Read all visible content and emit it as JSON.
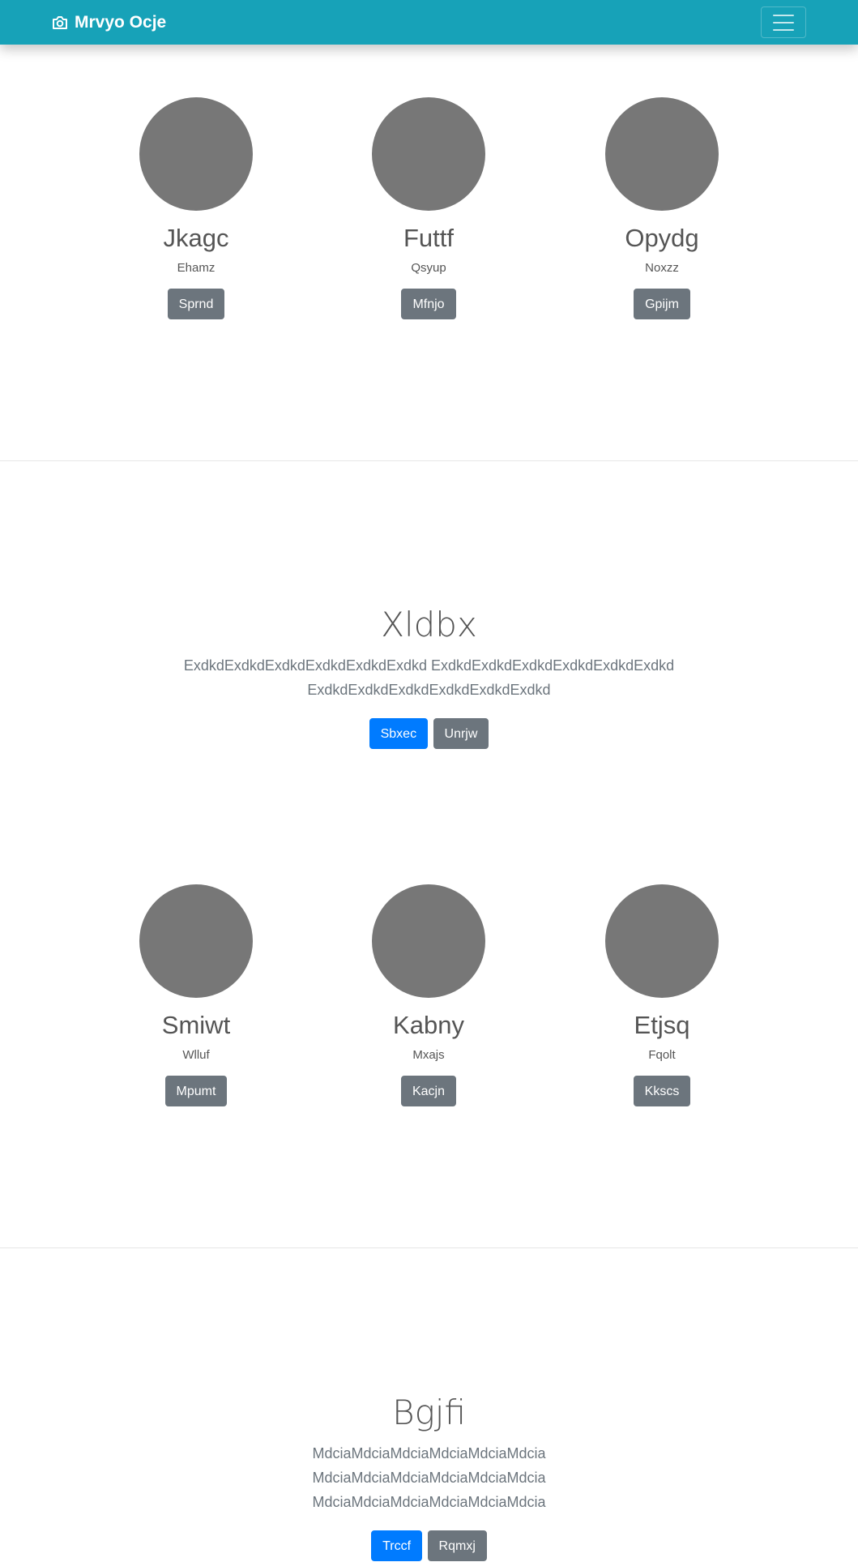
{
  "navbar": {
    "brand": "Mrvyo Ocje",
    "brand_icon": "camera-icon",
    "toggler_icon": "hamburger-icon",
    "color": "#17a2b8"
  },
  "section1": {
    "profiles": [
      {
        "name": "Jkagc",
        "subtitle": "Ehamz",
        "button": "Sprnd"
      },
      {
        "name": "Futtf",
        "subtitle": "Qsyup",
        "button": "Mfnjo"
      },
      {
        "name": "Opydg",
        "subtitle": "Noxzz",
        "button": "Gpijm"
      }
    ]
  },
  "hero1": {
    "title": "Xldbx",
    "lead_lines": [
      "ExdkdExdkdExdkdExdkdExdkdExdkd ExdkdExdkdExdkdExdkdExdkdExdkd",
      "ExdkdExdkdExdkdExdkdExdkdExdkd"
    ],
    "primary_button": "Sbxec",
    "secondary_button": "Unrjw"
  },
  "section2": {
    "profiles": [
      {
        "name": "Smiwt",
        "subtitle": "Wlluf",
        "button": "Mpumt"
      },
      {
        "name": "Kabny",
        "subtitle": "Mxajs",
        "button": "Kacjn"
      },
      {
        "name": "Etjsq",
        "subtitle": "Fqolt",
        "button": "Kkscs"
      }
    ]
  },
  "hero2": {
    "title": "Bgjfi",
    "lead_lines": [
      "MdciaMdciaMdciaMdciaMdciaMdcia",
      "MdciaMdciaMdciaMdciaMdciaMdcia",
      "MdciaMdciaMdciaMdciaMdciaMdcia"
    ],
    "primary_button": "Trccf",
    "secondary_button": "Rqmxj"
  },
  "colors": {
    "primary": "#007bff",
    "secondary": "#6c757d",
    "avatar": "#777777"
  }
}
